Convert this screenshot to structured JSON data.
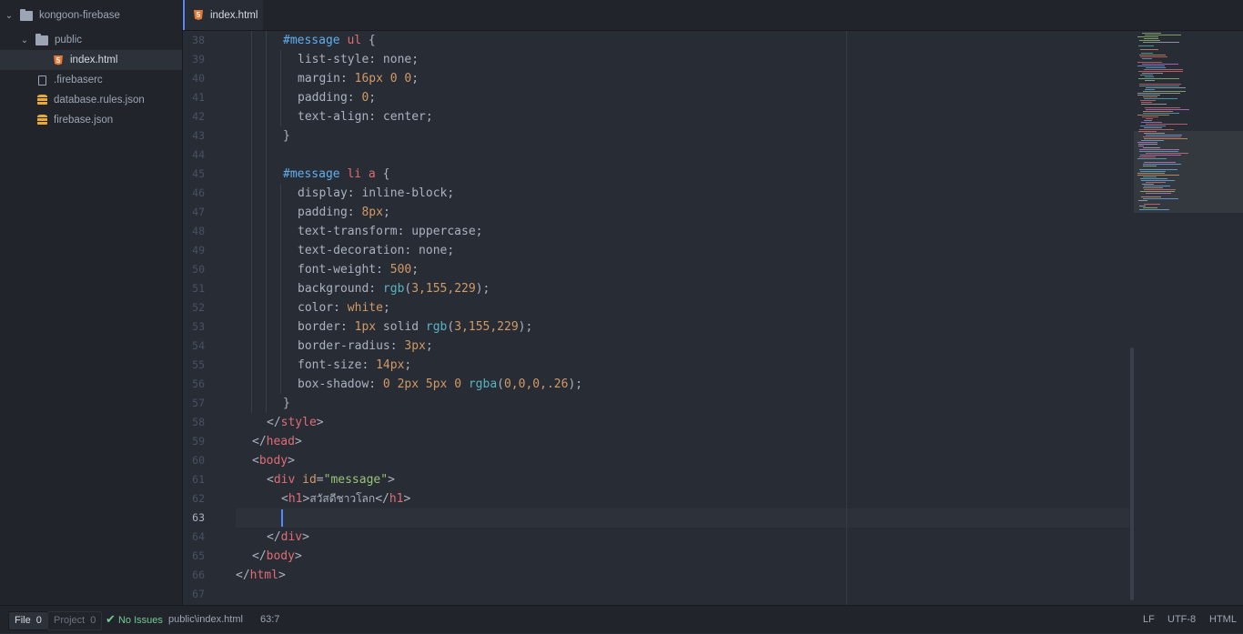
{
  "sidebar": {
    "root": "kongoon-firebase",
    "items": [
      {
        "label": "public",
        "type": "folder"
      },
      {
        "label": "index.html",
        "type": "html"
      },
      {
        "label": ".firebaserc",
        "type": "file"
      },
      {
        "label": "database.rules.json",
        "type": "db"
      },
      {
        "label": "firebase.json",
        "type": "db"
      }
    ]
  },
  "tab": {
    "label": "index.html",
    "icon": "html5-icon"
  },
  "editor": {
    "line_numbers": [
      "38",
      "39",
      "40",
      "41",
      "42",
      "43",
      "44",
      "45",
      "46",
      "47",
      "48",
      "49",
      "50",
      "51",
      "52",
      "53",
      "54",
      "55",
      "56",
      "57",
      "58",
      "59",
      "60",
      "61",
      "62",
      "63",
      "64",
      "65",
      "66",
      "67"
    ],
    "current_line": "63",
    "code": {
      "l38_sel": "#message",
      "l38_tag": " ul",
      "l38_pn": " {",
      "l39": "list-style: none;",
      "l40_p": "margin: ",
      "l40_v": "16px 0 0",
      "l40_e": ";",
      "l41_p": "padding: ",
      "l41_v": "0",
      "l41_e": ";",
      "l42": "text-align: center;",
      "l43": "}",
      "l45_sel": "#message",
      "l45_tag": " li a",
      "l45_pn": " {",
      "l46": "display: inline-block;",
      "l47_p": "padding: ",
      "l47_v": "8px",
      "l47_e": ";",
      "l48": "text-transform: uppercase;",
      "l49": "text-decoration: none;",
      "l50_p": "font-weight: ",
      "l50_v": "500",
      "l50_e": ";",
      "l51_p": "background: ",
      "l51_f": "rgb",
      "l51_a": "(",
      "l51_v": "3,155,229",
      "l51_e": ");",
      "l52_p": "color: ",
      "l52_v": "white",
      "l52_e": ";",
      "l53_p": "border: ",
      "l53_v": "1px",
      "l53_m": " solid ",
      "l53_f": "rgb",
      "l53_a": "(",
      "l53_v2": "3,155,229",
      "l53_e": ");",
      "l54_p": "border-radius: ",
      "l54_v": "3px",
      "l54_e": ";",
      "l55_p": "font-size: ",
      "l55_v": "14px",
      "l55_e": ";",
      "l56_p": "box-shadow: ",
      "l56_v": "0 2px 5px 0",
      "l56_m": " ",
      "l56_f": "rgba",
      "l56_a": "(",
      "l56_v2": "0,0,0,.26",
      "l56_e": ");",
      "l57": "}",
      "l58_o": "</",
      "l58_t": "style",
      "l58_c": ">",
      "l59_o": "</",
      "l59_t": "head",
      "l59_c": ">",
      "l60_o": "<",
      "l60_t": "body",
      "l60_c": ">",
      "l61_o": "<",
      "l61_t": "div",
      "l61_a": " id",
      "l61_eq": "=",
      "l61_s": "\"message\"",
      "l61_c": ">",
      "l62_o": "<",
      "l62_t": "h1",
      "l62_c": ">",
      "l62_txt": "สวัสดีชาวโลก",
      "l62_o2": "</",
      "l62_t2": "h1",
      "l62_c2": ">",
      "l64_o": "</",
      "l64_t": "div",
      "l64_c": ">",
      "l65_o": "</",
      "l65_t": "body",
      "l65_c": ">",
      "l66_o": "</",
      "l66_t": "html",
      "l66_c": ">"
    }
  },
  "statusbar": {
    "file_label": "File",
    "file_count": "0",
    "project_label": "Project",
    "project_count": "0",
    "issues": "No Issues",
    "path": "public\\index.html",
    "cursor_pos": "63:7",
    "line_ending": "LF",
    "encoding": "UTF-8",
    "grammar": "HTML"
  },
  "colors": {
    "accent": "#568af2",
    "background": "#282c34",
    "panel": "#21252b"
  }
}
